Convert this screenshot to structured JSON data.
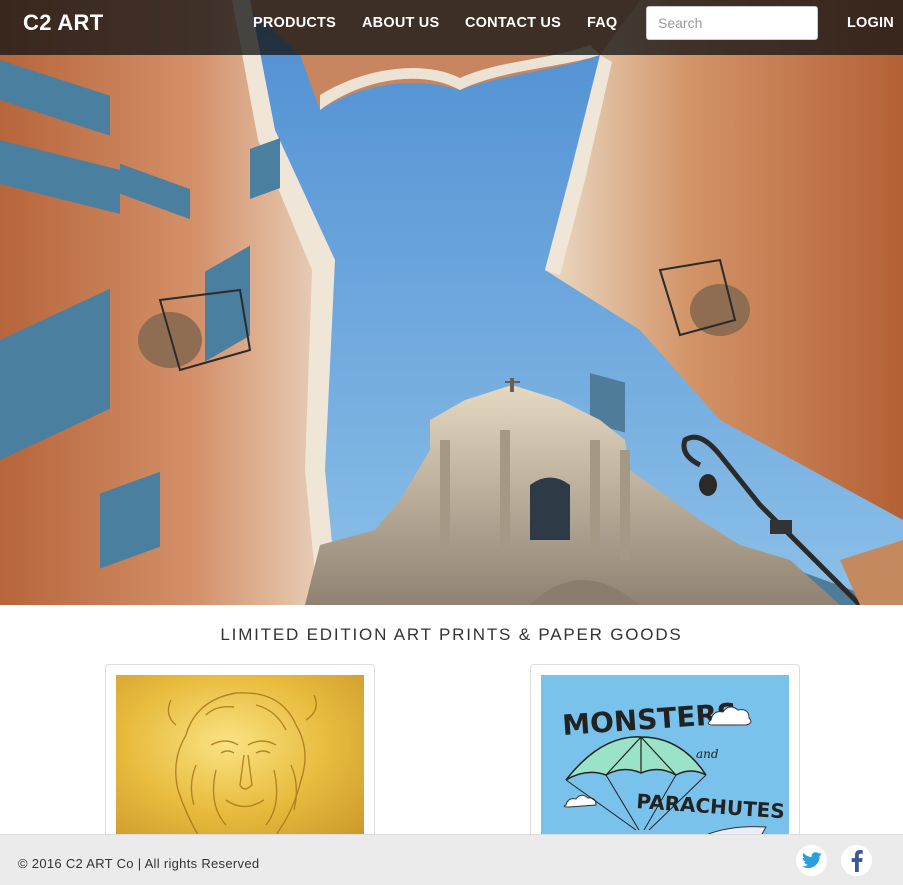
{
  "brand": {
    "name": "C2 ART"
  },
  "nav": {
    "products": "PRODUCTS",
    "about": "ABOUT US",
    "contact": "CONTACT US",
    "faq": "FAQ",
    "search_placeholder": "Search",
    "login": "LOGIN"
  },
  "hero": {
    "icon": "rome-church-upward-photo"
  },
  "main": {
    "heading": "LIMITED EDITION ART PRINTS & PAPER GOODS",
    "cards": [
      {
        "icon": "gold-lion-print"
      },
      {
        "icon": "monsters-and-parachutes-print",
        "art_text_1": "MONSTERS",
        "art_text_2": "and",
        "art_text_3": "PARACHUTES"
      }
    ]
  },
  "footer": {
    "copyright": "© 2016 C2 ART Co | All rights Reserved",
    "social": [
      {
        "icon": "twitter-icon"
      },
      {
        "icon": "facebook-icon"
      }
    ]
  },
  "colors": {
    "nav_bg": "#161616",
    "sky": "#5d95cf",
    "footer_bg": "#ebebeb",
    "twitter": "#1da1f2",
    "facebook": "#3b5998"
  }
}
